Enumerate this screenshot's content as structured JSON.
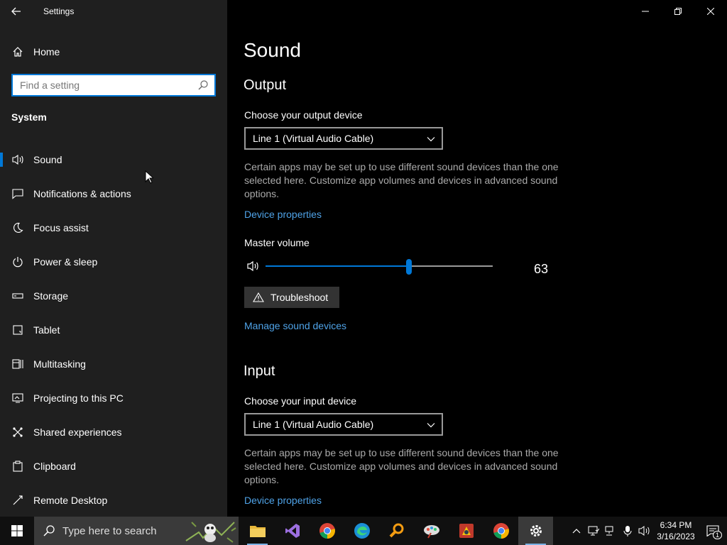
{
  "window": {
    "title": "Settings"
  },
  "sidebar": {
    "home_label": "Home",
    "search_placeholder": "Find a setting",
    "group_label": "System",
    "items": [
      {
        "label": "Sound",
        "icon": "speaker-icon",
        "selected": true
      },
      {
        "label": "Notifications & actions",
        "icon": "notification-icon"
      },
      {
        "label": "Focus assist",
        "icon": "moon-icon"
      },
      {
        "label": "Power & sleep",
        "icon": "power-icon"
      },
      {
        "label": "Storage",
        "icon": "storage-icon"
      },
      {
        "label": "Tablet",
        "icon": "tablet-icon"
      },
      {
        "label": "Multitasking",
        "icon": "multitasking-icon"
      },
      {
        "label": "Projecting to this PC",
        "icon": "projecting-icon"
      },
      {
        "label": "Shared experiences",
        "icon": "shared-icon"
      },
      {
        "label": "Clipboard",
        "icon": "clipboard-icon"
      },
      {
        "label": "Remote Desktop",
        "icon": "remote-desktop-icon"
      }
    ]
  },
  "main": {
    "title": "Sound",
    "output": {
      "heading": "Output",
      "device_label": "Choose your output device",
      "device_value": "Line 1 (Virtual Audio Cable)",
      "description": "Certain apps may be set up to use different sound devices than the one selected here. Customize app volumes and devices in advanced sound options.",
      "device_properties_link": "Device properties",
      "master_volume_label": "Master volume",
      "master_volume_value": "63",
      "master_volume": 63,
      "troubleshoot_label": "Troubleshoot",
      "manage_link": "Manage sound devices"
    },
    "input": {
      "heading": "Input",
      "device_label": "Choose your input device",
      "device_value": "Line 1 (Virtual Audio Cable)",
      "description": "Certain apps may be set up to use different sound devices than the one selected here. Customize app volumes and devices in advanced sound options.",
      "device_properties_link": "Device properties"
    }
  },
  "taskbar": {
    "search_label": "Type here to search",
    "apps": [
      {
        "icon": "file-explorer-icon",
        "running": true
      },
      {
        "icon": "visual-studio-icon"
      },
      {
        "icon": "chrome-icon"
      },
      {
        "icon": "edge-icon"
      },
      {
        "icon": "magnifier-app-icon"
      },
      {
        "icon": "paint-app-icon"
      },
      {
        "icon": "red-app-icon"
      },
      {
        "icon": "chrome-icon"
      },
      {
        "icon": "settings-gear-icon",
        "running": true,
        "active": true
      }
    ],
    "time": "6:34 PM",
    "date": "3/16/2023",
    "notification_count": "1"
  },
  "colors": {
    "accent": "#0078d7",
    "link": "#4fa3e8",
    "sidebar_bg": "#1f1f1f",
    "main_bg": "#000000"
  }
}
